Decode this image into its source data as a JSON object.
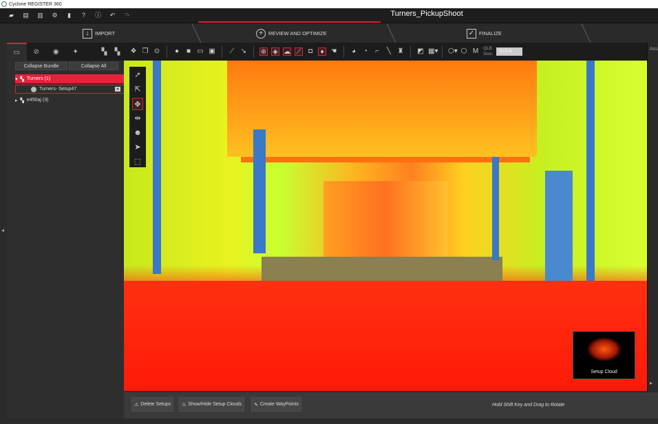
{
  "app": {
    "title": "Cyclone REGISTER 360",
    "document_title": "Turners_PickupShoot"
  },
  "menubar": {
    "icons": [
      "open-folder-icon",
      "open-project-icon",
      "export-icon",
      "gear-icon",
      "database-icon",
      "help-icon",
      "info-icon",
      "undo-icon",
      "redo-icon"
    ]
  },
  "workflow": {
    "steps": [
      {
        "label": "IMPORT",
        "icon": "import-icon"
      },
      {
        "label": "REVIEW AND OPTIMIZE",
        "icon": "review-icon",
        "active": true
      },
      {
        "label": "FINALIZE",
        "icon": "finalize-icon"
      }
    ]
  },
  "left_panel": {
    "collapse_bundle": "Collapse Bundle",
    "collapse_all": "Collapse All",
    "tree": [
      {
        "label": "Turners (1)",
        "selected": true,
        "expanded": true,
        "children": [
          {
            "label": "Turners- Setup47"
          }
        ]
      },
      {
        "label": "e450aj (3)",
        "expanded": false
      }
    ]
  },
  "toolbar": {
    "qlb_label": "QLB",
    "size_label": "Size:",
    "size_value": "10.0 m"
  },
  "right_strip": {
    "label": "Ass"
  },
  "viewport": {
    "minimap_label": "Setup Cloud",
    "colors": {
      "high": "#ff2010",
      "mid": "#ffb020",
      "low": "#c8f020",
      "outlier": "#3a78c8"
    }
  },
  "bottom": {
    "delete_setups": "Delete Setups",
    "show_hide": "Show/Hide Setup Clouds",
    "create_waypoints": "Create WayPoints",
    "hint": "Hold Shift Key and Drag to Rotate"
  },
  "accent": "#e0202e"
}
